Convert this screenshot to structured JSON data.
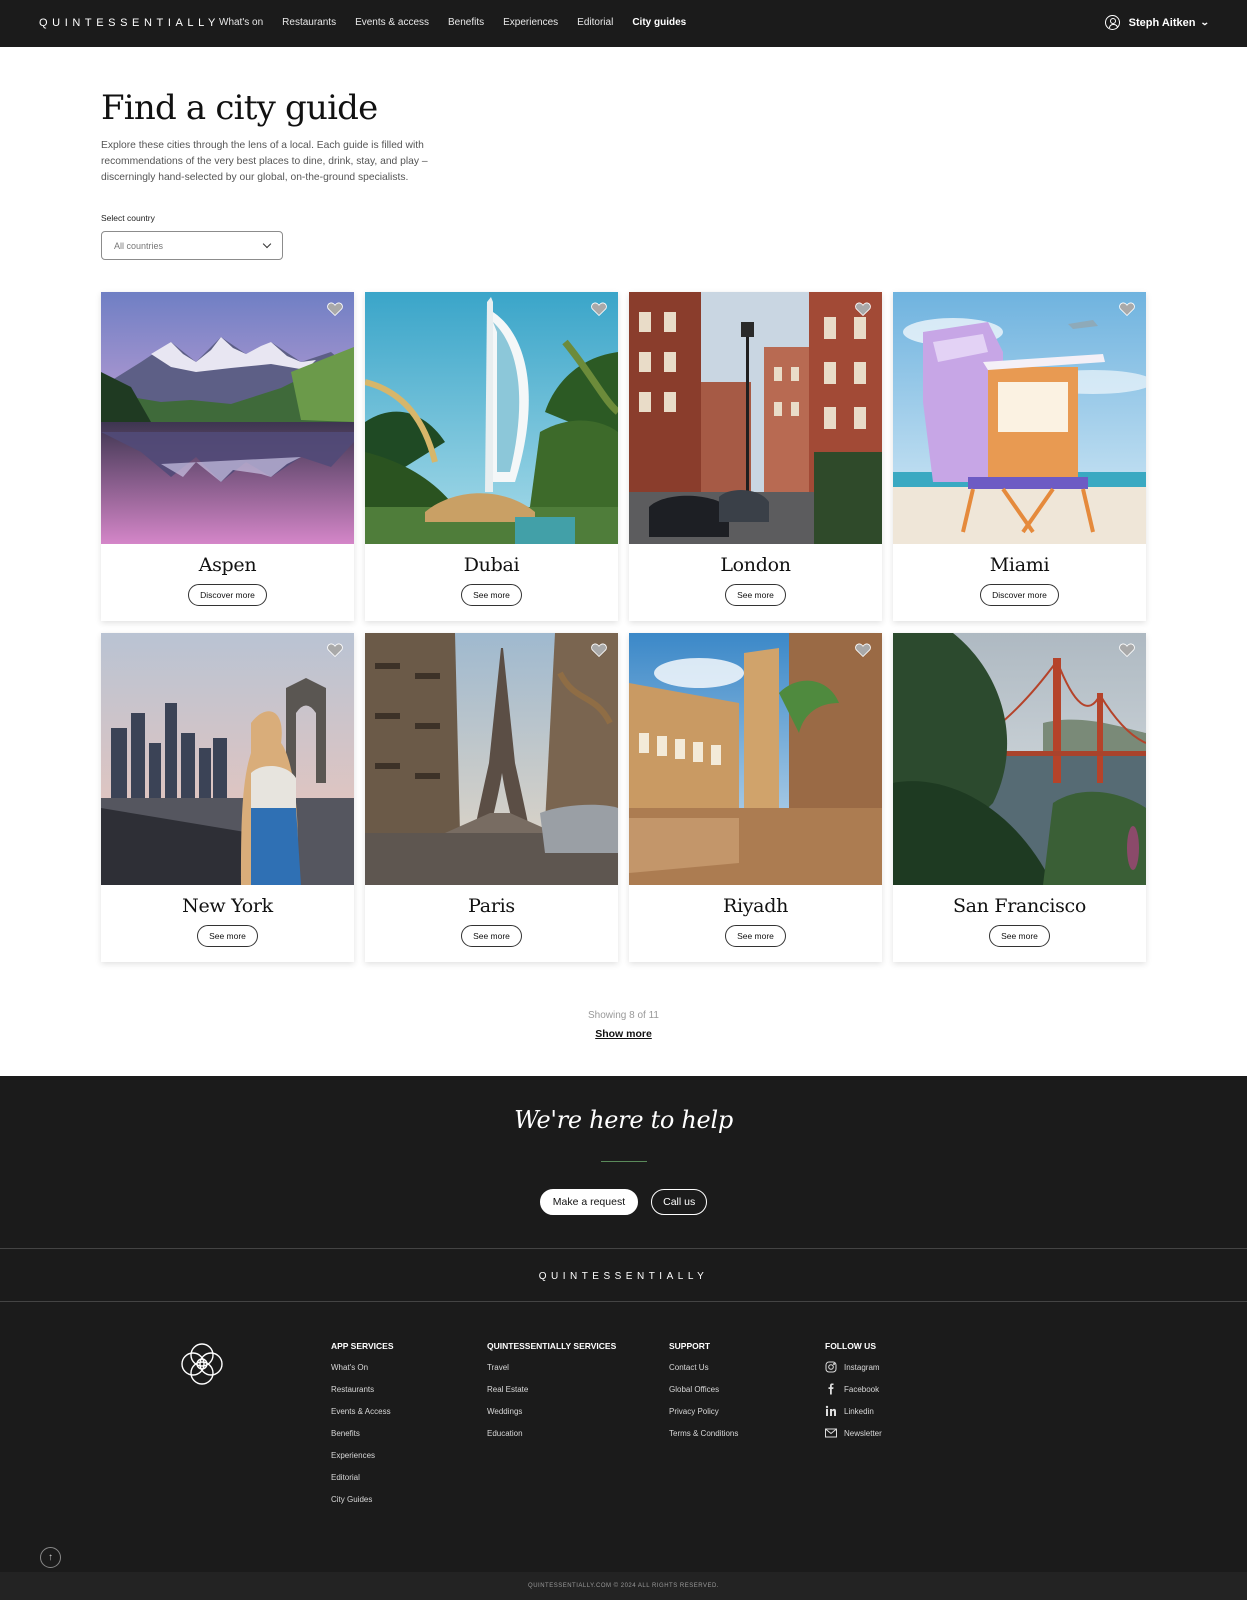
{
  "nav": {
    "brand": "QUINTESSENTIALLY",
    "links": [
      "What's on",
      "Restaurants",
      "Events & access",
      "Benefits",
      "Experiences",
      "Editorial",
      "City guides"
    ],
    "active": "City guides",
    "user": "Steph Aitken"
  },
  "hero": {
    "title": "Find a city guide",
    "intro": "Explore these cities through the lens of a local. Each guide is filled with recommendations of the very best places to dine, drink, stay, and play – discerningly hand-selected by our global, on-the-ground specialists.",
    "select_label": "Select country",
    "select_value": "All countries"
  },
  "cards": [
    {
      "city": "Aspen",
      "button": "Discover more"
    },
    {
      "city": "Dubai",
      "button": "See more"
    },
    {
      "city": "London",
      "button": "See more"
    },
    {
      "city": "Miami",
      "button": "Discover more"
    },
    {
      "city": "New York",
      "button": "See more"
    },
    {
      "city": "Paris",
      "button": "See more"
    },
    {
      "city": "Riyadh",
      "button": "See more"
    },
    {
      "city": "San Francisco",
      "button": "See more"
    }
  ],
  "pagination": {
    "showing": "Showing 8 of 11",
    "show_more": "Show more"
  },
  "help": {
    "title": "We're here to help",
    "request": "Make a request",
    "call": "Call us"
  },
  "footer": {
    "brand": "QUINTESSENTIALLY",
    "columns": [
      {
        "heading": "APP SERVICES",
        "links": [
          "What's On",
          "Restaurants",
          "Events & Access",
          "Benefits",
          "Experiences",
          "Editorial",
          "City Guides"
        ]
      },
      {
        "heading": "QUINTESSENTIALLY SERVICES",
        "links": [
          "Travel",
          "Real Estate",
          "Weddings",
          "Education"
        ]
      },
      {
        "heading": "SUPPORT",
        "links": [
          "Contact Us",
          "Global Offices",
          "Privacy Policy",
          "Terms & Conditions"
        ]
      },
      {
        "heading": "FOLLOW US",
        "links": [
          "Instagram",
          "Facebook",
          "Linkedin",
          "Newsletter"
        ]
      }
    ],
    "copyright": "QUINTESSENTIALLY.COM © 2024 ALL RIGHTS RESERVED."
  },
  "icons": [
    "user-icon",
    "chevron-down-icon",
    "heart-icon",
    "instagram-icon",
    "facebook-icon",
    "linkedin-icon",
    "mail-icon",
    "arrow-up-icon",
    "knot-logo-icon"
  ]
}
